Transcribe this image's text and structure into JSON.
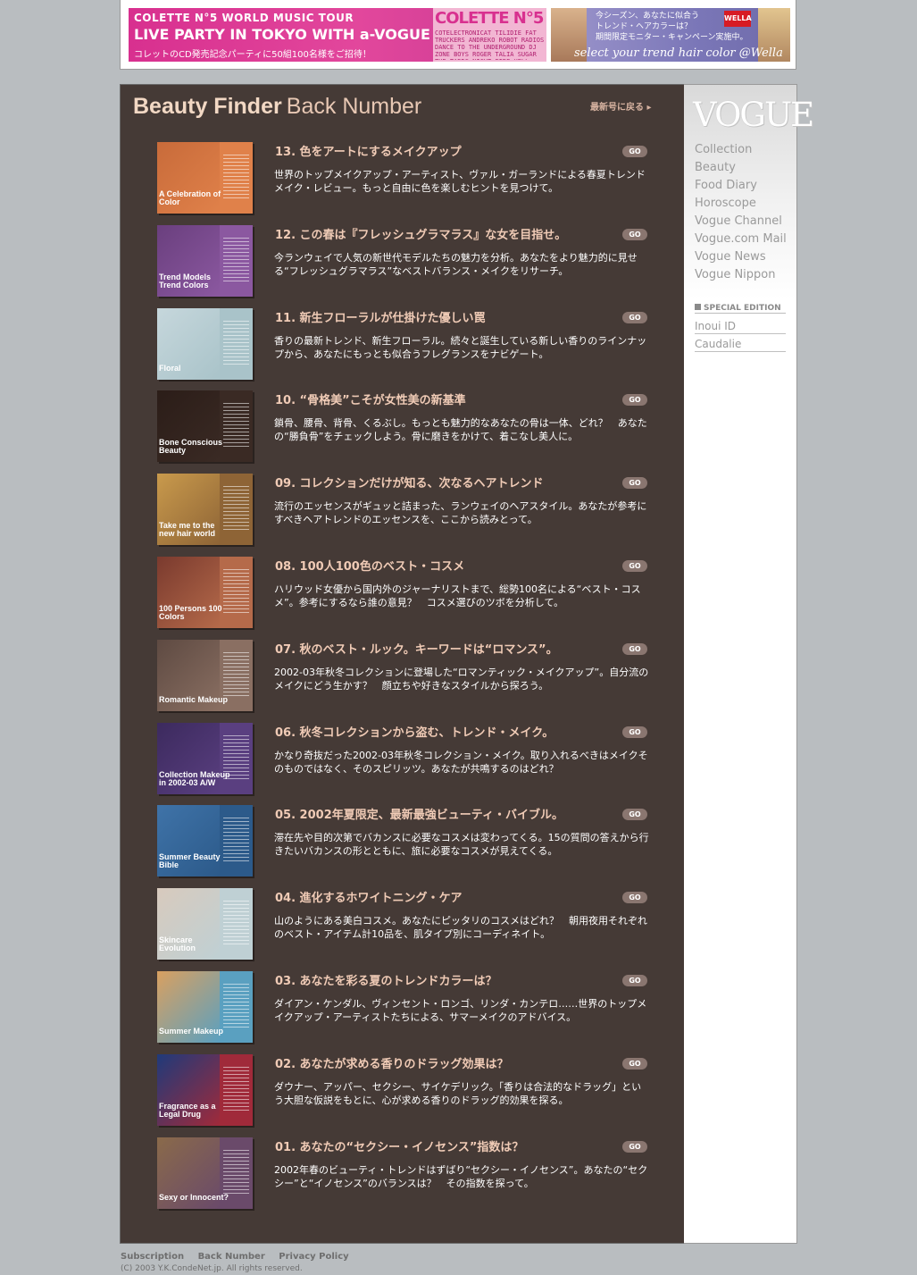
{
  "banner": {
    "left_ad": {
      "line1": "COLETTE N°5 WORLD MUSIC TOUR",
      "line2": "LIVE PARTY IN TOKYO WITH a-VOGUE",
      "line3": "コレットのCD発売記念パーティに50組100名様をご招待！",
      "brand": "COLETTE N°5",
      "brand_sub": "COTELECTRONICAT TILIDIE FAT TRUCKERS ANDREKO ROBOT RADIOS DANCE TO THE UNDERGROUND DJ ZONE BOYS ROGER TALIA SUGAR THE TARDS NIGHT FIRE HELL"
    },
    "right_ad": {
      "line1": "今シーズン、あなたに似合う",
      "line2": "トレンド・ヘアカラーは？",
      "line3": "期間限定モニター・キャンペーン実施中。",
      "tagline": "select your trend hair color @Wella",
      "brand": "WELLA"
    }
  },
  "header": {
    "title_bold": "Beauty Finder",
    "title_light": "Back Number",
    "back_link": "最新号に戻る ▸"
  },
  "go_label": "GO",
  "entries": [
    {
      "title": "13. 色をアートにするメイクアップ",
      "desc": "世界のトップメイクアップ・アーティスト、ヴァル・ガーランドによる春夏トレンドメイク・レビュー。もっと自由に色を楽しむヒントを見つけて。",
      "caption": "A Celebration of Color",
      "c1": "#c86b3a",
      "c2": "#e0814a"
    },
    {
      "title": "12. この春は『フレッシュグラマラス』な女を目指せ。",
      "desc": "今ランウェイで人気の新世代モデルたちの魅力を分析。あなたをより魅力的に見せる“フレッシュグラマラス”なベストバランス・メイクをリサーチ。",
      "caption": "Trend Models Trend Colors",
      "c1": "#6a3f7e",
      "c2": "#8b58a0"
    },
    {
      "title": "11. 新生フローラルが仕掛けた優しい罠",
      "desc": "香りの最新トレンド、新生フローラル。続々と誕生している新しい香りのラインナップから、あなたにもっとも似合うフレグランスをナビゲート。",
      "caption": "Floral",
      "c1": "#c6d7dc",
      "c2": "#a9c3c9"
    },
    {
      "title": "10. “骨格美”こそが女性美の新基準",
      "desc": "鎖骨、腰骨、背骨、くるぶし。もっとも魅力的なあなたの骨は一体、どれ？　あなたの“勝負骨”をチェックしよう。骨に磨きをかけて、着こなし美人に。",
      "caption": "Bone Conscious Beauty",
      "c1": "#2b1d18",
      "c2": "#3a2a24"
    },
    {
      "title": "09. コレクションだけが知る、次なるヘアトレンド",
      "desc": "流行のエッセンスがギュッと詰まった、ランウェイのヘアスタイル。あなたが参考にすべきヘアトレンドのエッセンスを、ここから読みとって。",
      "caption": "Take me to the new hair world",
      "c1": "#c99a4c",
      "c2": "#8e6436"
    },
    {
      "title": "08. 100人100色のベスト・コスメ",
      "desc": "ハリウッド女優から国内外のジャーナリストまで、総勢100名による“ベスト・コスメ”。参考にするなら誰の意見？　コスメ選びのツボを分析して。",
      "caption": "100 Persons 100 Colors",
      "c1": "#7a3a2e",
      "c2": "#b56a4a"
    },
    {
      "title": "07. 秋のベスト・ルック。キーワードは“ロマンス”。",
      "desc": "2002-03年秋冬コレクションに登場した“ロマンティック・メイクアップ”。自分流のメイクにどう生かす？　顔立ちや好きなスタイルから探ろう。",
      "caption": "Romantic Makeup",
      "c1": "#5e4a42",
      "c2": "#8a6f62"
    },
    {
      "title": "06. 秋冬コレクションから盗む、トレンド・メイク。",
      "desc": "かなり奇抜だった2002-03年秋冬コレクション・メイク。取り入れるべきはメイクそのものではなく、そのスピリッツ。あなたが共鳴するのはどれ？",
      "caption": "Collection Makeup in 2002-03 A/W",
      "c1": "#3c2a5e",
      "c2": "#5a3f80"
    },
    {
      "title": "05. 2002年夏限定、最新最強ビューティ・バイブル。",
      "desc": "滞在先や目的次第でバカンスに必要なコスメは変わってくる。15の質問の答えから行きたいバカンスの形とともに、旅に必要なコスメが見えてくる。",
      "caption": "Summer Beauty Bible",
      "c1": "#3f73a8",
      "c2": "#2c5a8a"
    },
    {
      "title": "04. 進化するホワイトニング・ケア",
      "desc": "山のようにある美白コスメ。あなたにピッタリのコスメはどれ？　朝用夜用それぞれのベスト・アイテム計10品を、肌タイプ別にコーディネイト。",
      "caption": "Skincare Evolution",
      "c1": "#d8cabd",
      "c2": "#bfd0d4"
    },
    {
      "title": "03. あなたを彩る夏のトレンドカラーは？",
      "desc": "ダイアン・ケンダル、ヴィンセント・ロンゴ、リンダ・カンテロ……世界のトップメイクアップ・アーティストたちによる、サマーメイクのアドバイス。",
      "caption": "Summer Makeup",
      "c1": "#d9a060",
      "c2": "#5aa0c0"
    },
    {
      "title": "02. あなたが求める香りのドラッグ効果は？",
      "desc": "ダウナー、アッパー、セクシー、サイケデリック。「香りは合法的なドラッグ」という大胆な仮説をもとに、心が求める香りのドラッグ的効果を探る。",
      "caption": "Fragrance as a Legal Drug",
      "c1": "#1f3a7a",
      "c2": "#a02a3a"
    },
    {
      "title": "01. あなたの“セクシー・イノセンス”指数は？",
      "desc": "2002年春のビューティ・トレンドはずばり“セクシー・イノセンス”。あなたの“セクシー”と“イノセンス”のバランスは？　その指数を探って。",
      "caption": "Sexy or Innocent?",
      "c1": "#8a6a4a",
      "c2": "#6a4a6a"
    }
  ],
  "sidebar": {
    "logo": "VOGUE",
    "nav": [
      "Collection",
      "Beauty",
      "Food Diary",
      "Horoscope",
      "Vogue Channel",
      "Vogue.com Mail",
      "Vogue News",
      "Vogue Nippon"
    ],
    "special_heading": "SPECIAL EDITION",
    "special_items": [
      "Inoui ID",
      "Caudalie"
    ]
  },
  "footer": {
    "links": [
      "Subscription",
      "Back Number",
      "Privacy Policy"
    ],
    "copyright": "(C) 2003 Y.K.CondeNet.jp. All rights reserved."
  },
  "colors": {
    "page_bg": "#b9bdc0",
    "panel_bg": "#453a36",
    "title_accent": "#f0cbb6",
    "go_button": "#8a7670",
    "sidebar_text": "#9a9a9a"
  }
}
